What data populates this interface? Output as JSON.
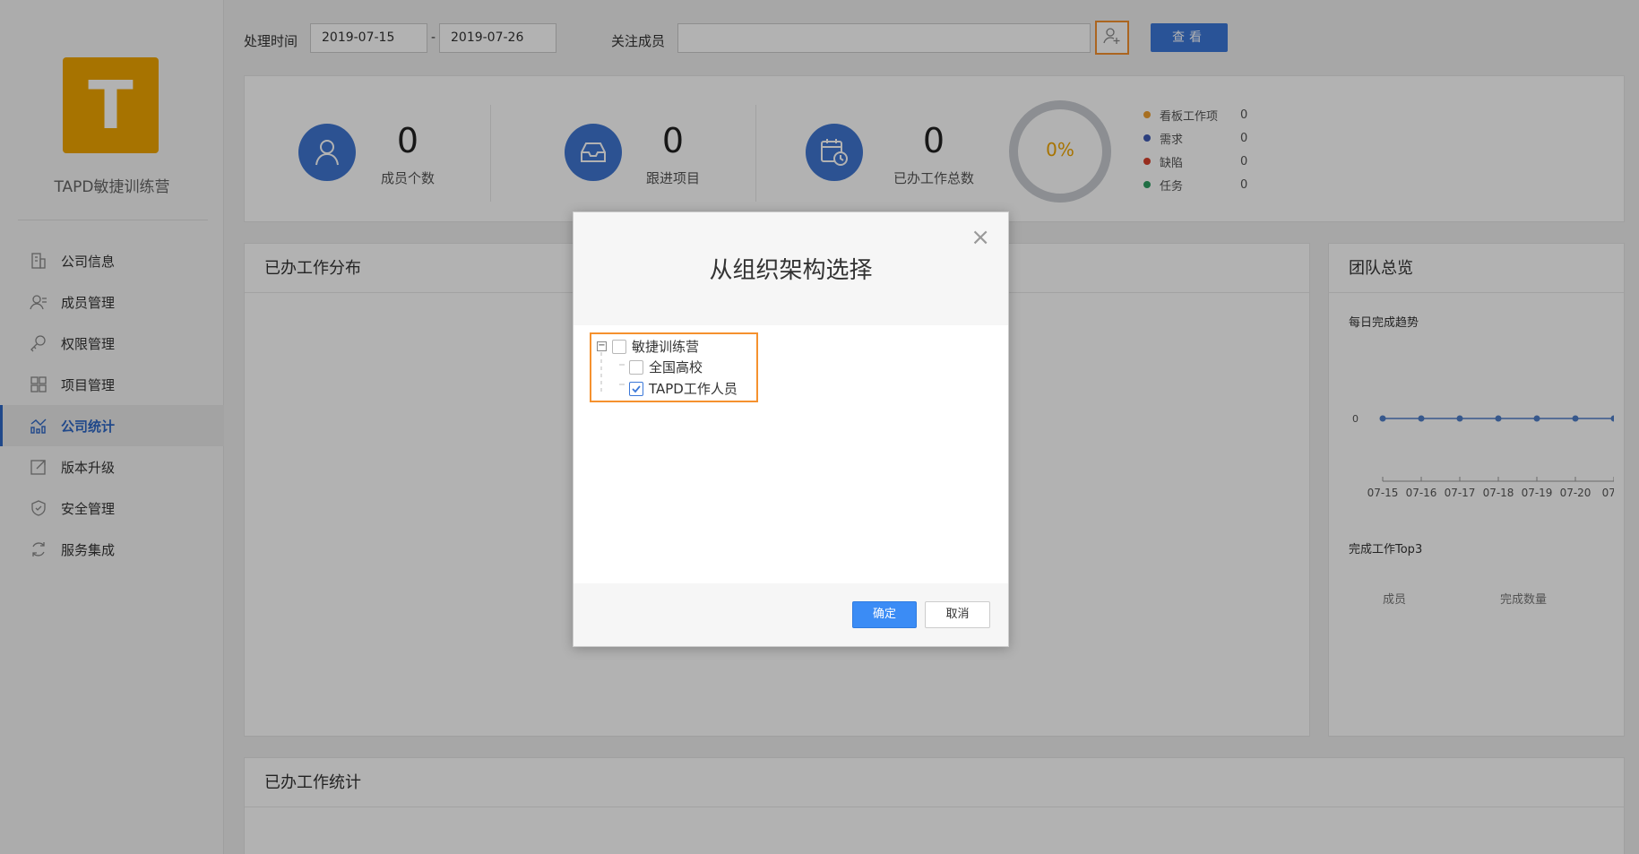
{
  "sidebar": {
    "logo_letter": "T",
    "org_name": "TAPD敏捷训练营",
    "items": [
      {
        "label": "公司信息",
        "icon": "building-icon",
        "active": false
      },
      {
        "label": "成员管理",
        "icon": "members-icon",
        "active": false
      },
      {
        "label": "权限管理",
        "icon": "key-icon",
        "active": false
      },
      {
        "label": "项目管理",
        "icon": "grid-icon",
        "active": false
      },
      {
        "label": "公司统计",
        "icon": "chart-icon",
        "active": true
      },
      {
        "label": "版本升级",
        "icon": "upgrade-icon",
        "active": false
      },
      {
        "label": "安全管理",
        "icon": "shield-icon",
        "active": false
      },
      {
        "label": "服务集成",
        "icon": "refresh-icon",
        "active": false
      }
    ]
  },
  "filter": {
    "time_label": "处理时间",
    "start_date": "2019-07-15",
    "separator": "-",
    "end_date": "2019-07-26",
    "member_label": "关注成员",
    "member_value": "",
    "view_button": "查看"
  },
  "stats": {
    "members": {
      "value": "0",
      "label": "成员个数"
    },
    "projects": {
      "value": "0",
      "label": "跟进项目"
    },
    "done": {
      "value": "0",
      "label": "已办工作总数"
    },
    "donut_percent": "0%",
    "legend": [
      {
        "label": "看板工作项",
        "value": "0",
        "color": "#f0a030"
      },
      {
        "label": "需求",
        "value": "0",
        "color": "#3f5bb5"
      },
      {
        "label": "缺陷",
        "value": "0",
        "color": "#d9412b"
      },
      {
        "label": "任务",
        "value": "0",
        "color": "#2e9e62"
      }
    ]
  },
  "panels": {
    "distribution_title": "已办工作分布",
    "team_title": "团队总览",
    "trend_title": "每日完成趋势",
    "top3_title": "完成工作Top3",
    "top3_col_member": "成员",
    "top3_col_count": "完成数量",
    "stats_title": "已办工作统计"
  },
  "chart_data": {
    "type": "line",
    "title": "每日完成趋势",
    "categories": [
      "07-15",
      "07-16",
      "07-17",
      "07-18",
      "07-19",
      "07-20",
      "07..."
    ],
    "series": [
      {
        "values": [
          0,
          0,
          0,
          0,
          0,
          0,
          0
        ]
      }
    ],
    "y_ticks": [
      "0"
    ],
    "color": "#4f7fc9"
  },
  "modal": {
    "title": "从组织架构选择",
    "close": "×",
    "tree": [
      {
        "label": "敏捷训练营",
        "checked": false,
        "level": 0
      },
      {
        "label": "全国高校",
        "checked": false,
        "level": 1
      },
      {
        "label": "TAPD工作人员",
        "checked": true,
        "level": 1
      }
    ],
    "ok_button": "确定",
    "cancel_button": "取消"
  }
}
